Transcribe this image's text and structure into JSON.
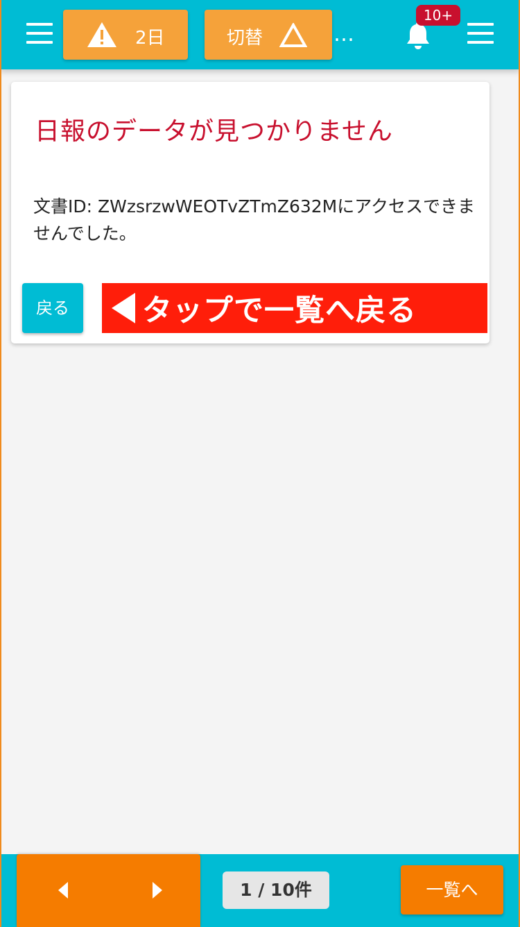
{
  "header": {
    "alert_label": "2日",
    "switch_label": "切替",
    "more_label": "…",
    "notification_count": "10+",
    "colors": {
      "bar": "#00bcd4",
      "button": "#f5a23a",
      "badge": "#c8102e"
    },
    "icons": [
      "menu-icon",
      "warning-icon",
      "triangle-outline-icon",
      "ellipsis-icon",
      "bell-icon",
      "menu-icon"
    ]
  },
  "card": {
    "title": "日報のデータが見つかりません",
    "message": "文書ID: ZWzsrzwWEOTvZTmZ632Mにアクセスできませんでした。",
    "back_label": "戻る",
    "tap_banner": "タップで一覧へ戻る",
    "colors": {
      "title": "#c8102e",
      "banner": "#ff1e0a",
      "back_button": "#00bcd4"
    }
  },
  "footer": {
    "page_indicator": "1 / 10件",
    "list_label": "一覧へ",
    "icons": [
      "prev-arrow-icon",
      "next-arrow-icon"
    ],
    "colors": {
      "bar": "#00bcd4",
      "nav": "#f57c00"
    }
  }
}
